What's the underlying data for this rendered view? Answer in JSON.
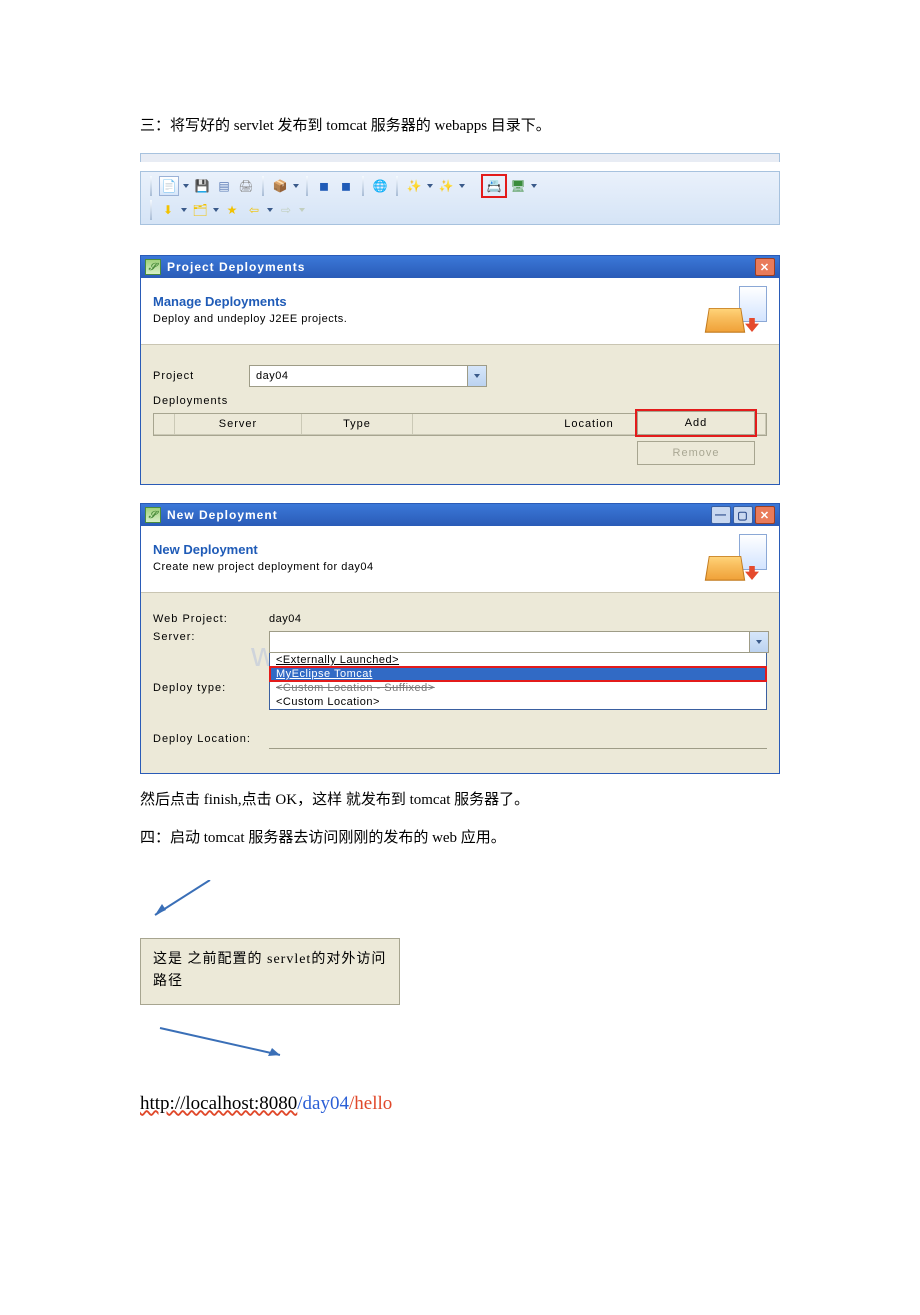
{
  "text": {
    "heading_three": "三：将写好的 servlet 发布到 tomcat 服务器的 webapps 目录下。",
    "after_finish": "然后点击 finish,点击 OK，这样 就发布到 tomcat 服务器了。",
    "heading_four": "四：启动 tomcat 服务器去访问刚刚的发布的 web 应用。",
    "callout": "这是  之前配置的  servlet的对外访问路径"
  },
  "dialog1": {
    "title": "Project Deployments",
    "heading": "Manage Deployments",
    "sub": "Deploy and undeploy J2EE projects.",
    "project_label": "Project",
    "project_value": "day04",
    "deployments_label": "Deployments",
    "columns": {
      "server": "Server",
      "type": "Type",
      "location": "Location"
    },
    "buttons": {
      "add": "Add",
      "remove": "Remove"
    }
  },
  "dialog2": {
    "title": "New Deployment",
    "heading": "New Deployment",
    "sub": "Create new project deployment for day04",
    "rows": {
      "web_project_label": "Web Project:",
      "web_project_value": "day04",
      "server_label": "Server:",
      "deploy_type_label": "Deploy type:",
      "deploy_loc_label": "Deploy Location:"
    },
    "options": {
      "opt0": "<Externally Launched>",
      "opt1": "MyEclipse Tomcat",
      "opt2": "<Custom Location - Suffixed>",
      "opt3": "<Custom Location>"
    }
  },
  "url": {
    "part1": "http://localhost:8080",
    "part2": "/day04",
    "part3": "/hello"
  },
  "watermark": "www.bdocx.com"
}
